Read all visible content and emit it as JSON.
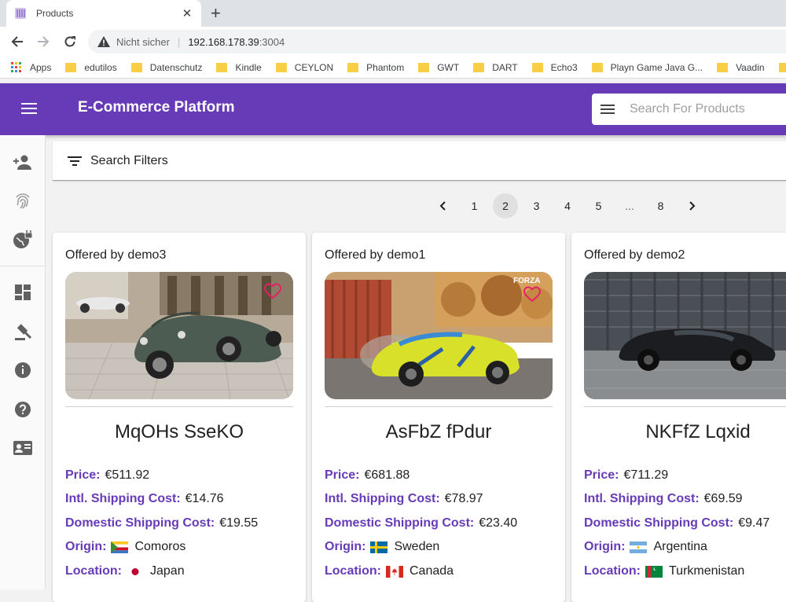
{
  "browser": {
    "tab_title": "Products",
    "close_glyph": "✕",
    "new_tab_glyph": "+",
    "insecure_label": "Nicht sicher",
    "url_host": "192.168.178.39",
    "url_port": ":3004",
    "bookmarks": [
      "Apps",
      "edutilos",
      "Datenschutz",
      "Kindle",
      "CEYLON",
      "Phantom",
      "GWT",
      "DART",
      "Echo3",
      "Playn Game Java G...",
      "Vaadin"
    ]
  },
  "app": {
    "title": "E-Commerce Platform",
    "search_placeholder": "Search For Products",
    "brand_color": "#673ab7"
  },
  "sidenav": {
    "icons": [
      "add-user-icon",
      "fingerprint-icon",
      "globe-lock-icon",
      "dashboard-icon",
      "gavel-icon",
      "info-icon",
      "help-icon",
      "contact-card-icon"
    ]
  },
  "filters": {
    "label": "Search Filters"
  },
  "pagination": {
    "prev": "‹",
    "next": "›",
    "pages": [
      "1",
      "2",
      "3",
      "4",
      "5",
      "...",
      "8"
    ],
    "active_page": "2"
  },
  "products": [
    {
      "offered_label": "Offered by",
      "seller": "demo3",
      "title": "MqOHs SseKO",
      "price_label": "Price:",
      "price": "€511.92",
      "intl_label": "Intl. Shipping Cost:",
      "intl": "€14.76",
      "domestic_label": "Domestic Shipping Cost:",
      "domestic": "€19.55",
      "origin_label": "Origin:",
      "origin": "Comoros",
      "location_label": "Location:",
      "location": "Japan"
    },
    {
      "offered_label": "Offered by",
      "seller": "demo1",
      "title": "AsFbZ fPdur",
      "price_label": "Price:",
      "price": "€681.88",
      "intl_label": "Intl. Shipping Cost:",
      "intl": "€78.97",
      "domestic_label": "Domestic Shipping Cost:",
      "domestic": "€23.40",
      "origin_label": "Origin:",
      "origin": "Sweden",
      "location_label": "Location:",
      "location": "Canada",
      "image_watermark": "FORZA"
    },
    {
      "offered_label": "Offered by",
      "seller": "demo2",
      "title": "NKFfZ Lqxid",
      "price_label": "Price:",
      "price": "€711.29",
      "intl_label": "Intl. Shipping Cost:",
      "intl": "€69.59",
      "domestic_label": "Domestic Shipping Cost:",
      "domestic": "€9.47",
      "origin_label": "Origin:",
      "origin": "Argentina",
      "location_label": "Location:",
      "location": "Turkmenistan"
    }
  ]
}
